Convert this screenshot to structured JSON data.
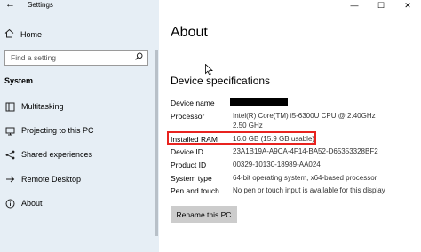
{
  "window": {
    "title": "Settings",
    "back": "←",
    "minimize": "—",
    "maximize": "☐",
    "close": "✕"
  },
  "sidebar": {
    "home_label": "Home",
    "search_placeholder": "Find a setting",
    "section_label": "System",
    "items": [
      {
        "label": "Multitasking",
        "icon": "multitasking-icon"
      },
      {
        "label": "Projecting to this PC",
        "icon": "projecting-icon"
      },
      {
        "label": "Shared experiences",
        "icon": "shared-experiences-icon"
      },
      {
        "label": "Remote Desktop",
        "icon": "remote-desktop-icon"
      },
      {
        "label": "About",
        "icon": "info-icon"
      }
    ]
  },
  "main": {
    "title": "About",
    "spec_heading": "Device specifications",
    "specs": [
      {
        "label": "Device name",
        "value": ""
      },
      {
        "label": "Processor",
        "value": "Intel(R) Core(TM) i5-6300U CPU @ 2.40GHz",
        "value2": "2.50 GHz"
      },
      {
        "label": "Installed RAM",
        "value": "16.0 GB (15.9 GB usable)"
      },
      {
        "label": "Device ID",
        "value": "23A1B19A-A9CA-4F14-BA52-D65353328BF2"
      },
      {
        "label": "Product ID",
        "value": "00329-10130-18989-AA024"
      },
      {
        "label": "System type",
        "value": "64-bit operating system, x64-based processor"
      },
      {
        "label": "Pen and touch",
        "value": "No pen or touch input is available for this display"
      }
    ],
    "rename_button": "Rename this PC"
  },
  "colors": {
    "sidebar_bg": "#e6eef5",
    "highlight": "#e8231f",
    "button_bg": "#cccccc"
  }
}
